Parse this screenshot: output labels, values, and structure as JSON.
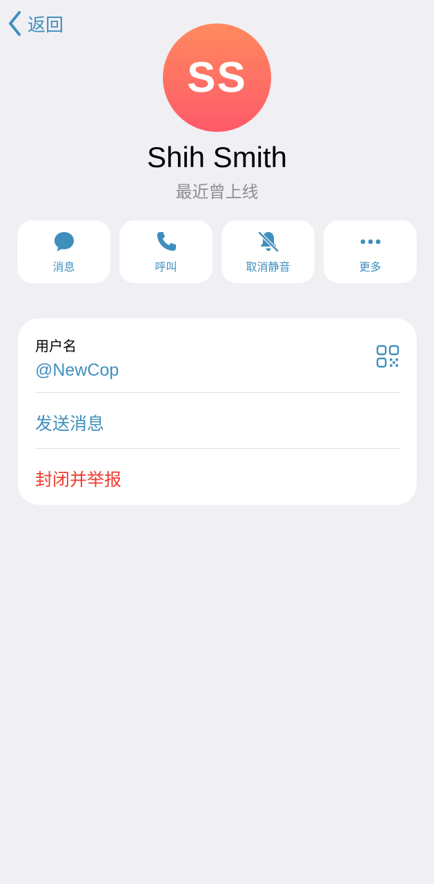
{
  "nav": {
    "back_label": "返回"
  },
  "profile": {
    "initials": "SS",
    "name": "Shih Smith",
    "status": "最近曾上线",
    "avatar_gradient": [
      "#ff8a5e",
      "#ff5a6a"
    ]
  },
  "actions": [
    {
      "label": "消息",
      "icon": "message-bubble-icon"
    },
    {
      "label": "呼叫",
      "icon": "phone-icon"
    },
    {
      "label": "取消静音",
      "icon": "bell-slash-icon"
    },
    {
      "label": "更多",
      "icon": "ellipsis-icon"
    }
  ],
  "info": {
    "username_caption": "用户名",
    "username_value": "@NewCop",
    "send_message_label": "发送消息",
    "block_report_label": "封闭并举报"
  },
  "colors": {
    "accent": "#3f8fbd",
    "danger": "#ef3b30",
    "background": "#efeff4"
  }
}
